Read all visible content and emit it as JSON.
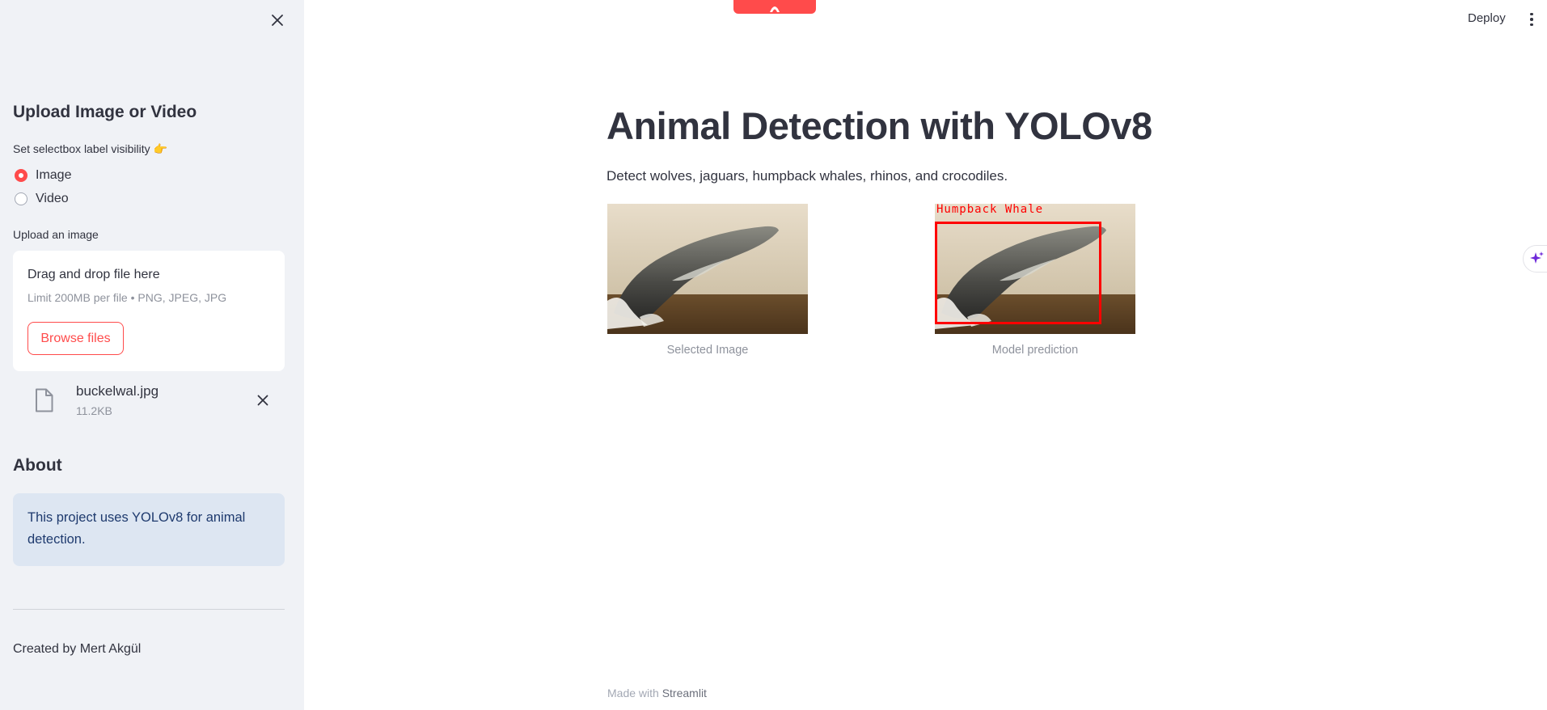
{
  "sidebar": {
    "upload_heading": "Upload Image or Video",
    "selectbox_label": "Set selectbox label visibility 👉",
    "radio_options": [
      {
        "label": "Image",
        "selected": true
      },
      {
        "label": "Video",
        "selected": false
      }
    ],
    "upload_label": "Upload an image",
    "uploader": {
      "drag_text": "Drag and drop file here",
      "limit_text": "Limit 200MB per file • PNG, JPEG, JPG",
      "browse_label": "Browse files"
    },
    "uploaded_file": {
      "name": "buckelwal.jpg",
      "size": "11.2KB"
    },
    "about_heading": "About",
    "about_text": "This project uses YOLOv8 for animal detection.",
    "created_by": "Created by Mert Akgül"
  },
  "header": {
    "deploy_label": "Deploy"
  },
  "main": {
    "title": "Animal Detection with YOLOv8",
    "description": "Detect wolves, jaguars, humpback whales, rhinos, and crocodiles.",
    "images": [
      {
        "caption": "Selected Image"
      },
      {
        "caption": "Model prediction",
        "detection_label": "Humpback Whale"
      }
    ]
  },
  "footer": {
    "prefix": "Made with",
    "brand": "Streamlit"
  },
  "colors": {
    "accent": "#ff4b4b",
    "sidebar_bg": "#f0f2f6",
    "info_bg": "#dde6f2",
    "detection_box": "#ff0000"
  }
}
